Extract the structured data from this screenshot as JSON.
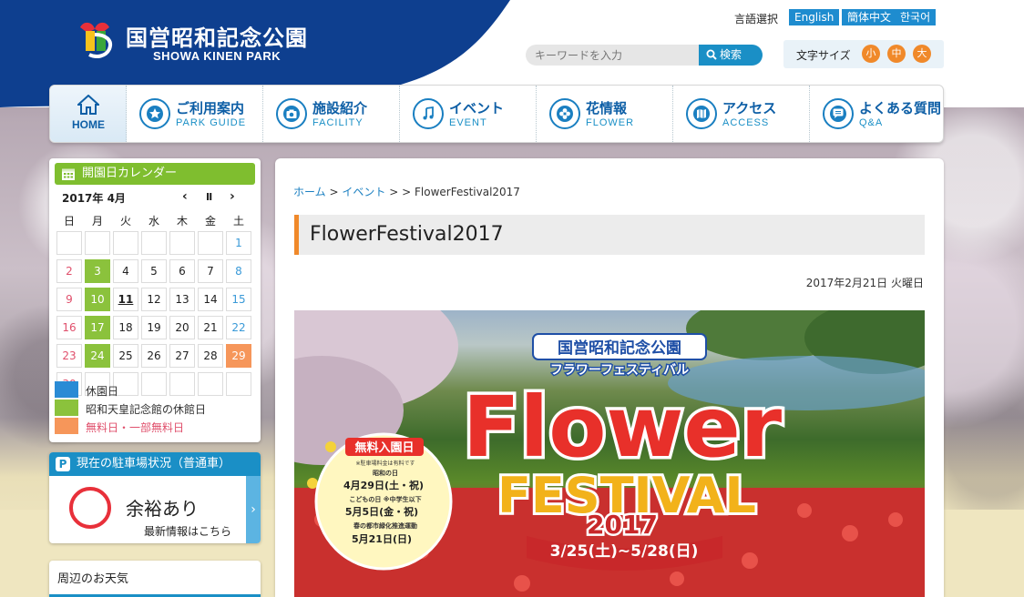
{
  "header": {
    "logo_jp": "国営昭和記念公園",
    "logo_en": "SHOWA KINEN PARK",
    "lang_label": "言語選択",
    "languages": [
      "English",
      "簡体中文",
      "한국어"
    ],
    "search_placeholder": "キーワードを入力",
    "search_button": "検索",
    "fontsize_label": "文字サイズ",
    "fontsizes": [
      "小",
      "中",
      "大"
    ]
  },
  "nav": [
    {
      "jp": "HOME",
      "en": ""
    },
    {
      "jp": "ご利用案内",
      "en": "PARK GUIDE",
      "icon": "star-icon"
    },
    {
      "jp": "施設紹介",
      "en": "FACILITY",
      "icon": "camera-icon"
    },
    {
      "jp": "イベント",
      "en": "EVENT",
      "icon": "music-note-icon"
    },
    {
      "jp": "花情報",
      "en": "FLOWER",
      "icon": "flower-icon"
    },
    {
      "jp": "アクセス",
      "en": "ACCESS",
      "icon": "map-icon"
    },
    {
      "jp": "よくある質問",
      "en": "Q&A",
      "icon": "speech-bubble-icon"
    }
  ],
  "calendar": {
    "title": "開園日カレンダー",
    "month": "2017年 4月",
    "prev": "‹",
    "pause": "Ⅱ",
    "next": "›",
    "weekdays": [
      "日",
      "月",
      "火",
      "水",
      "木",
      "金",
      "土"
    ],
    "weeks": [
      [
        "",
        "",
        "",
        "",
        "",
        "",
        "1"
      ],
      [
        "2",
        "3",
        "4",
        "5",
        "6",
        "7",
        "8"
      ],
      [
        "9",
        "10",
        "11",
        "12",
        "13",
        "14",
        "15"
      ],
      [
        "16",
        "17",
        "18",
        "19",
        "20",
        "21",
        "22"
      ],
      [
        "23",
        "24",
        "25",
        "26",
        "27",
        "28",
        "29"
      ],
      [
        "30",
        "",
        "",
        "",
        "",
        "",
        ""
      ]
    ],
    "museum_closed_days": [
      "3",
      "10",
      "17",
      "24"
    ],
    "free_days": [
      "29"
    ],
    "today": "11",
    "legend": [
      {
        "label": "休園日",
        "color": "#2a8bd5"
      },
      {
        "label": "昭和天皇記念館の休館日",
        "color": "#8bc23c"
      },
      {
        "label": "無料日・一部無料日",
        "color": "#f6965a"
      }
    ]
  },
  "parking": {
    "title": "現在の駐車場状況（普通車）",
    "p_icon": "P",
    "status": "余裕あり",
    "more": "最新情報はこちら",
    "arrow": "›"
  },
  "weather": {
    "title": "周辺のお天気"
  },
  "main": {
    "breadcrumb_home": "ホーム",
    "breadcrumb_event": "イベント",
    "breadcrumb_sep": ">",
    "breadcrumb_current": "FlowerFestival2017",
    "title": "FlowerFestival2017",
    "date": "2017年2月21日 火曜日"
  },
  "poster": {
    "park_name": "国営昭和記念公園",
    "subtitle": "フラワーフェスティバル",
    "flower": "Flower",
    "festival": "FESTIVAL",
    "year": "2017",
    "dates": "3/25(土)~5/28(日)",
    "free_title": "無料入園日",
    "free_note": "※駐車場料金は有料です",
    "day1_title": "昭和の日",
    "day1_date": "4月29日(土・祝)",
    "day2_title": "こどもの日 ※中学生以下",
    "day2_date": "5月5日(金・祝)",
    "day3_title": "春の都市緑化推進運動",
    "day3_date": "5月21日(日)"
  },
  "colors": {
    "brand_navy": "#0e3f8f",
    "nav_blue": "#0e5fa6",
    "accent_orange": "#f0892a",
    "calendar_green": "#7fbe2f",
    "parking_blue": "#1a8fc6"
  }
}
